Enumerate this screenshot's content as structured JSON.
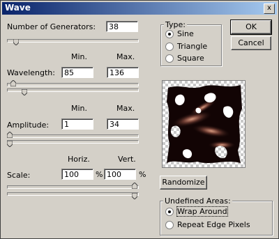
{
  "window": {
    "title": "Wave",
    "close_glyph": "x"
  },
  "generators": {
    "label": "Number of Generators:",
    "value": "38",
    "slider_fraction": 0.05
  },
  "wavelength": {
    "label": "Wavelength:",
    "min_header": "Min.",
    "max_header": "Max.",
    "min": "85",
    "max": "136",
    "min_slider_fraction": 0.03,
    "max_slider_fraction": 0.12
  },
  "amplitude": {
    "label": "Amplitude:",
    "min_header": "Min.",
    "max_header": "Max.",
    "min": "1",
    "max": "34",
    "min_slider_fraction": 0.0,
    "max_slider_fraction": 0.0
  },
  "scale": {
    "label": "Scale:",
    "horiz_header": "Horiz.",
    "vert_header": "Vert.",
    "horiz": "100",
    "vert": "100",
    "unit": "%",
    "horiz_slider_fraction": 1.0,
    "vert_slider_fraction": 1.0
  },
  "type": {
    "title": "Type:",
    "options": [
      "Sine",
      "Triangle",
      "Square"
    ],
    "selected": "Sine"
  },
  "buttons": {
    "ok": "OK",
    "cancel": "Cancel",
    "randomize": "Randomize"
  },
  "undefined_areas": {
    "title": "Undefined Areas:",
    "options": [
      "Wrap Around",
      "Repeat Edge Pixels"
    ],
    "selected": "Wrap Around"
  }
}
